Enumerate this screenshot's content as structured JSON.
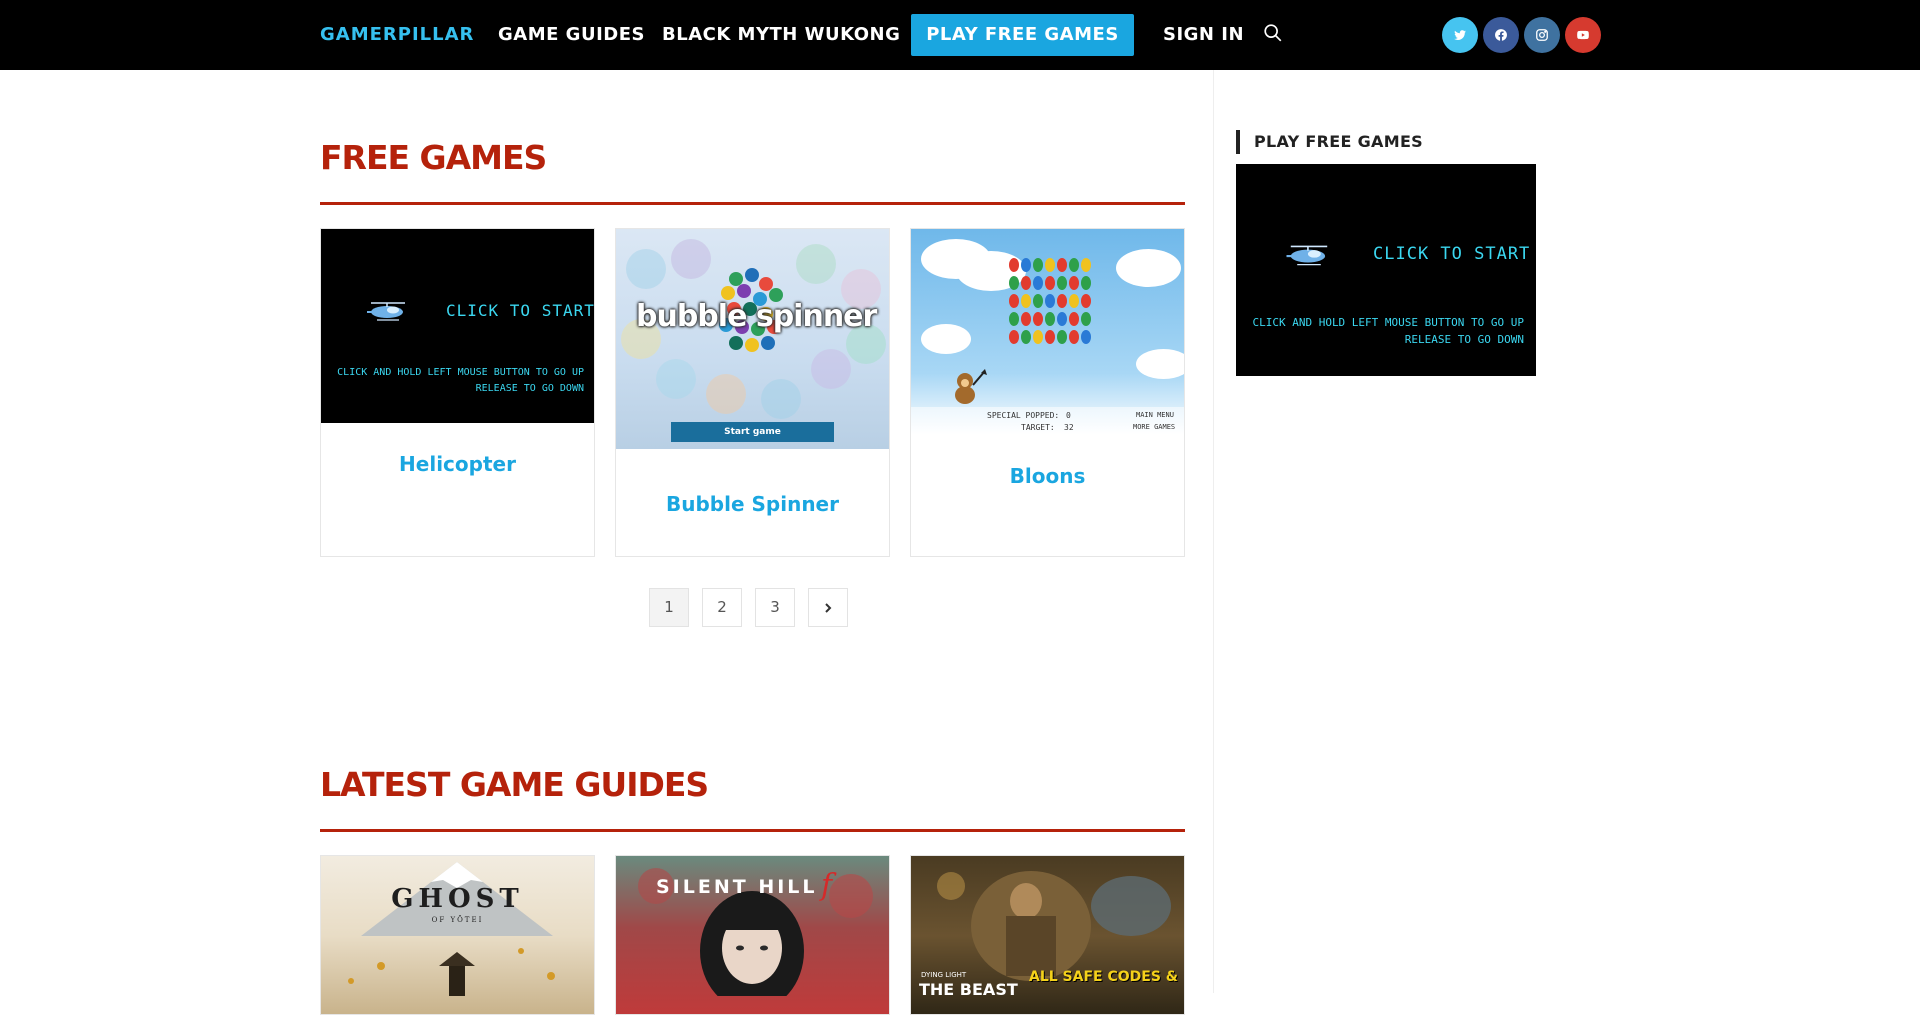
{
  "nav": {
    "brand": "GAMERPILLAR",
    "links": [
      "GAME GUIDES",
      "BLACK MYTH WUKONG"
    ],
    "cta": "PLAY FREE GAMES",
    "signin": "SIGN IN",
    "social": [
      {
        "name": "twitter",
        "icon": "twitter-icon",
        "color": "#46c4f0"
      },
      {
        "name": "facebook",
        "icon": "facebook-icon",
        "color": "#3b5a9a"
      },
      {
        "name": "instagram",
        "icon": "instagram-icon",
        "color": "#3f72a0"
      },
      {
        "name": "youtube",
        "icon": "youtube-icon",
        "color": "#d63a2f"
      }
    ]
  },
  "free_games": {
    "title": "FREE GAMES",
    "cards": [
      {
        "title": "Helicopter",
        "thumb_lines": [
          "CLICK TO START",
          "CLICK AND HOLD LEFT MOUSE BUTTON TO GO UP",
          "RELEASE TO GO DOWN"
        ]
      },
      {
        "title": "Bubble Spinner",
        "thumb_logo": "bubble spinner",
        "thumb_button": "Start game"
      },
      {
        "title": "Bloons",
        "thumb_hud": [
          "SPECIAL POPPED:",
          "0",
          "TARGET:",
          "32",
          "MAIN MENU",
          "MORE GAMES"
        ]
      }
    ]
  },
  "pagination": {
    "pages": [
      "1",
      "2",
      "3"
    ],
    "current": "1",
    "next_icon": "chevron-right-icon"
  },
  "latest_guides": {
    "title": "LATEST GAME GUIDES",
    "cards": [
      {
        "thumb_text": "GHOST",
        "thumb_sub": "OF YŌTEI"
      },
      {
        "thumb_text": "SILENT HILL",
        "thumb_accent": "f"
      },
      {
        "thumb_text": "THE BEAST",
        "thumb_sub": "DYING LIGHT",
        "thumb_banner": "ALL SAFE CODES &"
      }
    ]
  },
  "sidebar": {
    "widget_title": "PLAY FREE GAMES",
    "thumb_lines": [
      "CLICK TO START",
      "CLICK AND HOLD LEFT MOUSE BUTTON TO GO UP",
      "RELEASE TO GO DOWN"
    ]
  },
  "colors": {
    "accent": "#1aa6e0",
    "heading": "#b5220b",
    "nav_bg": "#000000"
  }
}
